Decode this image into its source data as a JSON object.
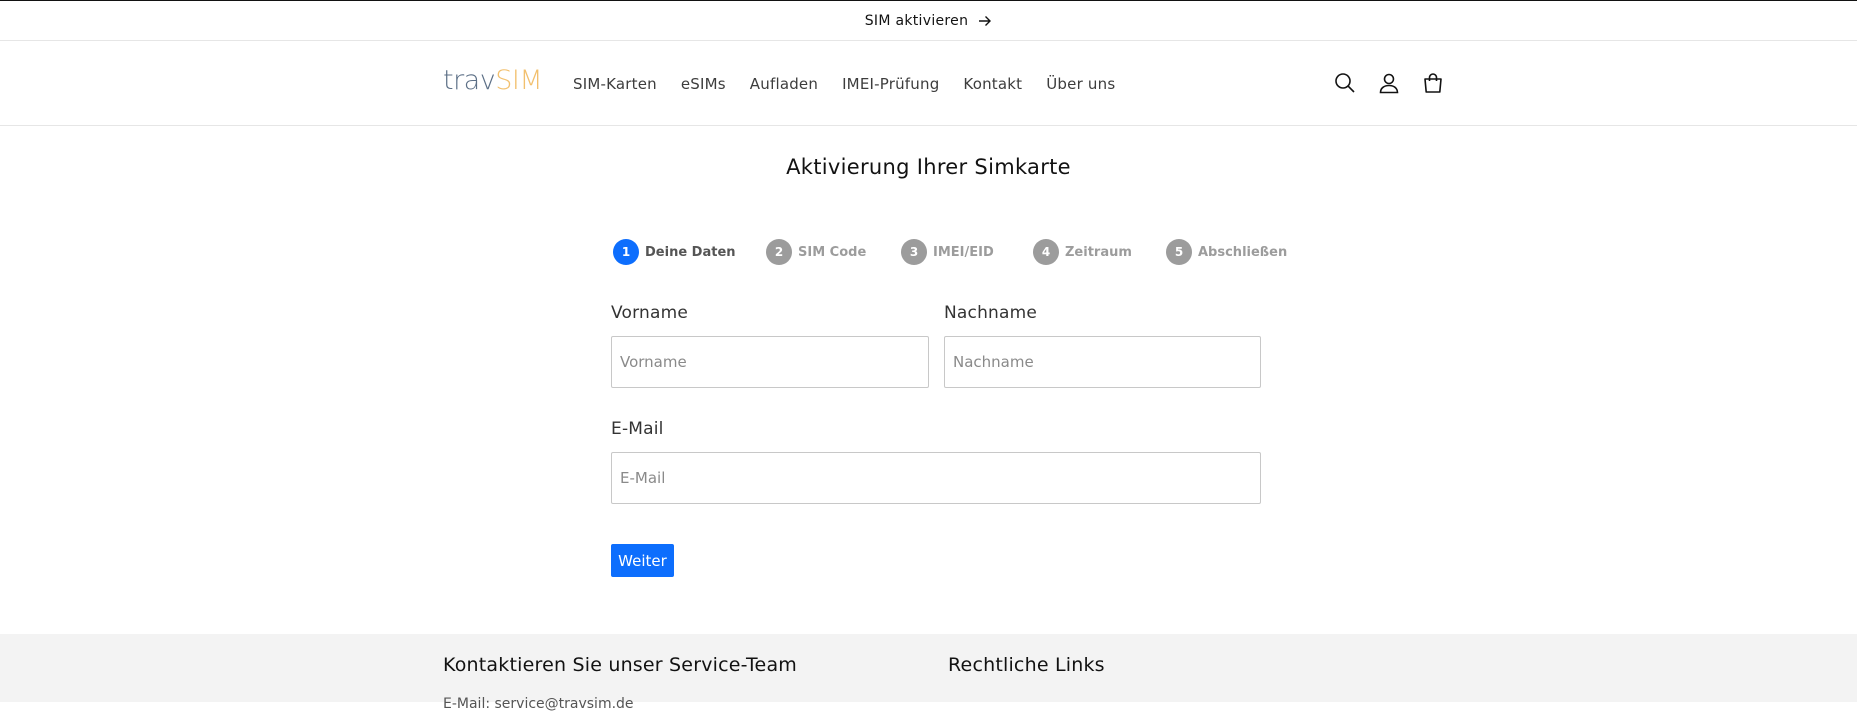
{
  "announcement": {
    "text": "SIM aktivieren",
    "icon": "arrow-right-icon"
  },
  "header": {
    "logo": {
      "part1": "trav",
      "part2": "SIM",
      "color1": "#5c6f86",
      "color2": "#f2c06e"
    },
    "nav": [
      {
        "label": "SIM-Karten"
      },
      {
        "label": "eSIMs"
      },
      {
        "label": "Aufladen"
      },
      {
        "label": "IMEI-Prüfung"
      },
      {
        "label": "Kontakt"
      },
      {
        "label": "Über uns"
      }
    ],
    "icons": [
      "search-icon",
      "account-icon",
      "cart-icon"
    ]
  },
  "main": {
    "title": "Aktivierung Ihrer Simkarte",
    "steps": [
      {
        "number": "1",
        "label": "Deine Daten",
        "active": true
      },
      {
        "number": "2",
        "label": "SIM Code",
        "active": false
      },
      {
        "number": "3",
        "label": "IMEI/EID",
        "active": false
      },
      {
        "number": "4",
        "label": "Zeitraum",
        "active": false
      },
      {
        "number": "5",
        "label": "Abschließen",
        "active": false
      }
    ],
    "form": {
      "firstname": {
        "label": "Vorname",
        "placeholder": "Vorname",
        "value": ""
      },
      "lastname": {
        "label": "Nachname",
        "placeholder": "Nachname",
        "value": ""
      },
      "email": {
        "label": "E-Mail",
        "placeholder": "E-Mail",
        "value": ""
      },
      "submit_label": "Weiter"
    },
    "accent_color": "#0d6efd"
  },
  "footer": {
    "contact_heading": "Kontaktieren Sie unser Service-Team",
    "contact_sub": "E-Mail: service@travsim.de",
    "legal_heading": "Rechtliche Links"
  }
}
